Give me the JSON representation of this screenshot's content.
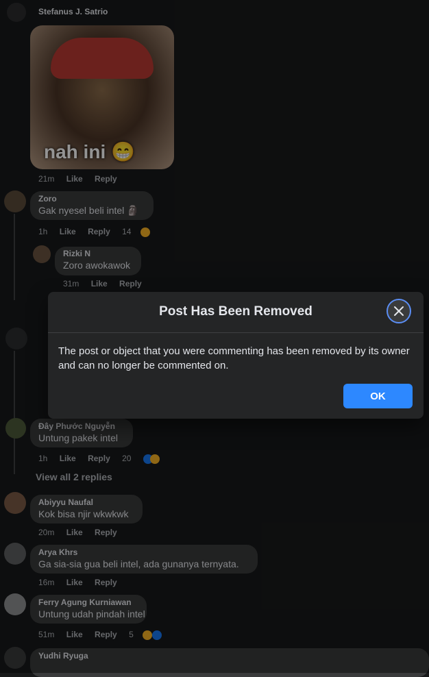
{
  "comments": [
    {
      "author": "Stefanus J. Satrio",
      "sticker_text": "nah ini 😁",
      "time": "21m",
      "like": "Like",
      "reply": "Reply"
    },
    {
      "author": "Zoro",
      "text": "Gak nyesel beli intel 🗿",
      "time": "1h",
      "like": "Like",
      "reply": "Reply",
      "reactions": "14"
    },
    {
      "author": "Rizki N",
      "text": "Zoro awokawok",
      "time": "31m",
      "like": "Like",
      "reply": "Reply"
    },
    {
      "author": "Đây Phước Nguyễn",
      "text": "Untung pakek intel",
      "time": "1h",
      "like": "Like",
      "reply": "Reply",
      "reactions": "20"
    },
    {
      "author": "Abiyyu Naufal",
      "text": "Kok bisa njir wkwkwk",
      "time": "20m",
      "like": "Like",
      "reply": "Reply"
    },
    {
      "author": "Arya Khrs",
      "text": "Ga sia-sia gua beli intel, ada gunanya ternyata.",
      "time": "16m",
      "like": "Like",
      "reply": "Reply"
    },
    {
      "author": "Ferry Agung Kurniawan",
      "text": "Untung udah pindah intel",
      "time": "51m",
      "like": "Like",
      "reply": "Reply",
      "reactions": "5"
    },
    {
      "author": "Yudhi Ryuga"
    }
  ],
  "view_replies": "View all 2 replies",
  "dialog": {
    "title": "Post Has Been Removed",
    "body": "The post or object that you were commenting has been removed by its owner and can no longer be commented on.",
    "ok": "OK",
    "close_icon": "close-icon"
  },
  "colors": {
    "background": "#18191a",
    "dialog": "#242526",
    "primary": "#2d88ff"
  }
}
